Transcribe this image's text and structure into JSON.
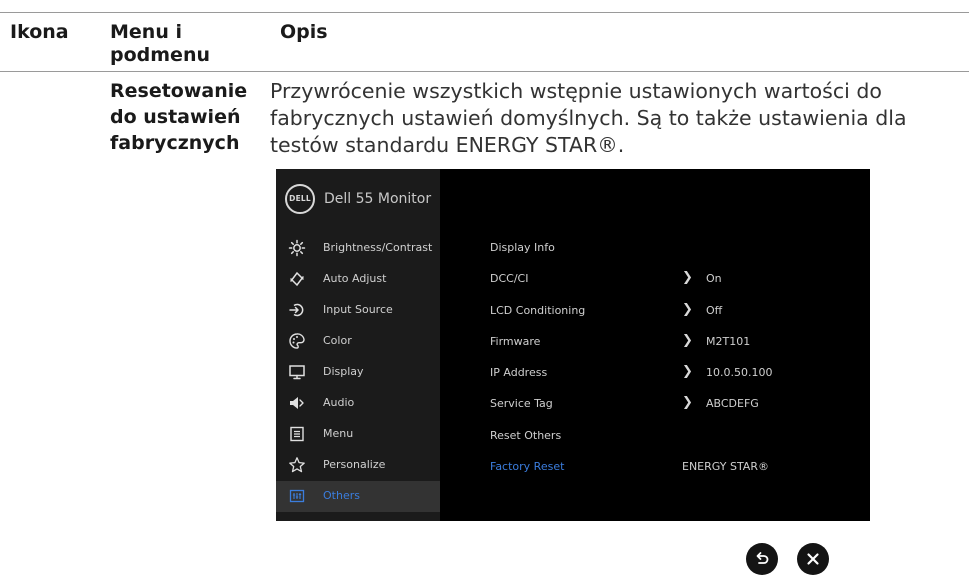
{
  "table": {
    "headers": {
      "icon": "Ikona",
      "menu": "Menu i\npodmenu",
      "description": "Opis"
    },
    "row": {
      "menu_name": "Resetowanie\ndo ustawień\nfabrycznych",
      "description": "Przywrócenie wszystkich wstępnie ustawionych wartości do fabrycznych ustawień domyślnych. Są to także ustawienia dla testów standardu ENERGY STAR®."
    }
  },
  "osd": {
    "logo_text": "DELL",
    "title": "Dell 55 Monitor",
    "accent_color": "#3b7ddd",
    "sidebar": [
      {
        "label": "Brightness/Contrast",
        "icon": "brightness-icon"
      },
      {
        "label": "Auto Adjust",
        "icon": "auto-adjust-icon"
      },
      {
        "label": "Input Source",
        "icon": "input-source-icon"
      },
      {
        "label": "Color",
        "icon": "color-palette-icon"
      },
      {
        "label": "Display",
        "icon": "display-monitor-icon"
      },
      {
        "label": "Audio",
        "icon": "speaker-icon"
      },
      {
        "label": "Menu",
        "icon": "menu-list-icon"
      },
      {
        "label": "Personalize",
        "icon": "star-icon"
      },
      {
        "label": "Others",
        "icon": "others-icon",
        "active": true
      }
    ],
    "items": [
      {
        "label": "Display Info",
        "value": ""
      },
      {
        "label": "DCC/CI",
        "value": "On"
      },
      {
        "label": "LCD Conditioning",
        "value": "Off"
      },
      {
        "label": "Firmware",
        "value": "M2T101"
      },
      {
        "label": "IP Address",
        "value": "10.0.50.100"
      },
      {
        "label": "Service Tag",
        "value": "ABCDEFG"
      },
      {
        "label": "Reset Others",
        "value": ""
      },
      {
        "label": "Factory Reset",
        "value": "ENERGY STAR®",
        "highlighted": true
      }
    ]
  },
  "buttons": {
    "back": "back-icon",
    "close": "close-icon"
  }
}
